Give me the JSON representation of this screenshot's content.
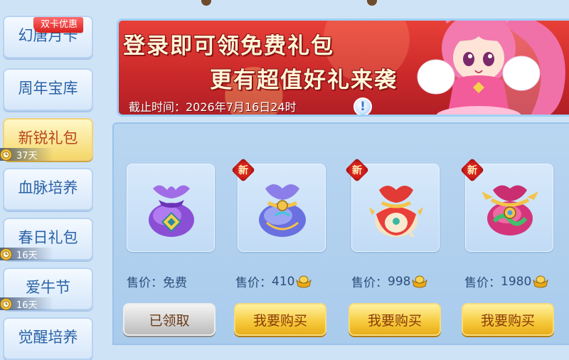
{
  "sidebar": {
    "badge": "双卡优惠",
    "items": [
      {
        "label": "幻唐月卡",
        "timer": ""
      },
      {
        "label": "周年宝库",
        "timer": ""
      },
      {
        "label": "新锐礼包",
        "timer": "37天"
      },
      {
        "label": "血脉培养",
        "timer": ""
      },
      {
        "label": "春日礼包",
        "timer": "16天"
      },
      {
        "label": "爱牛节",
        "timer": "16天"
      },
      {
        "label": "觉醒培养",
        "timer": ""
      }
    ],
    "active_index": 2
  },
  "banner": {
    "line1": "登录即可领免费礼包",
    "line2": "更有超值好礼来袭",
    "deadline": "截止时间：2026年7月16日24时",
    "info_icon": "!"
  },
  "products": [
    {
      "is_new": false,
      "new_label": "",
      "price_label": "售价：免费",
      "price": "",
      "currency_icon": "",
      "button": "已领取",
      "claimed": true,
      "icon": "purple-bag-icon"
    },
    {
      "is_new": true,
      "new_label": "新",
      "price_label": "售价：",
      "price": "410",
      "currency_icon": "gold-ingot-icon",
      "button": "我要购买",
      "claimed": false,
      "icon": "blue-bag-icon"
    },
    {
      "is_new": true,
      "new_label": "新",
      "price_label": "售价：",
      "price": "998",
      "currency_icon": "gold-ingot-icon",
      "button": "我要购买",
      "claimed": false,
      "icon": "red-bag-icon"
    },
    {
      "is_new": true,
      "new_label": "新",
      "price_label": "售价：",
      "price": "1980",
      "currency_icon": "gold-ingot-icon",
      "button": "我要购买",
      "claimed": false,
      "icon": "dragon-bag-icon"
    }
  ],
  "colors": {
    "accent_gold": "#f6c93a",
    "banner_red": "#cc2a2a",
    "sidebar_text": "#2a62a6",
    "active_text": "#b7461a"
  }
}
